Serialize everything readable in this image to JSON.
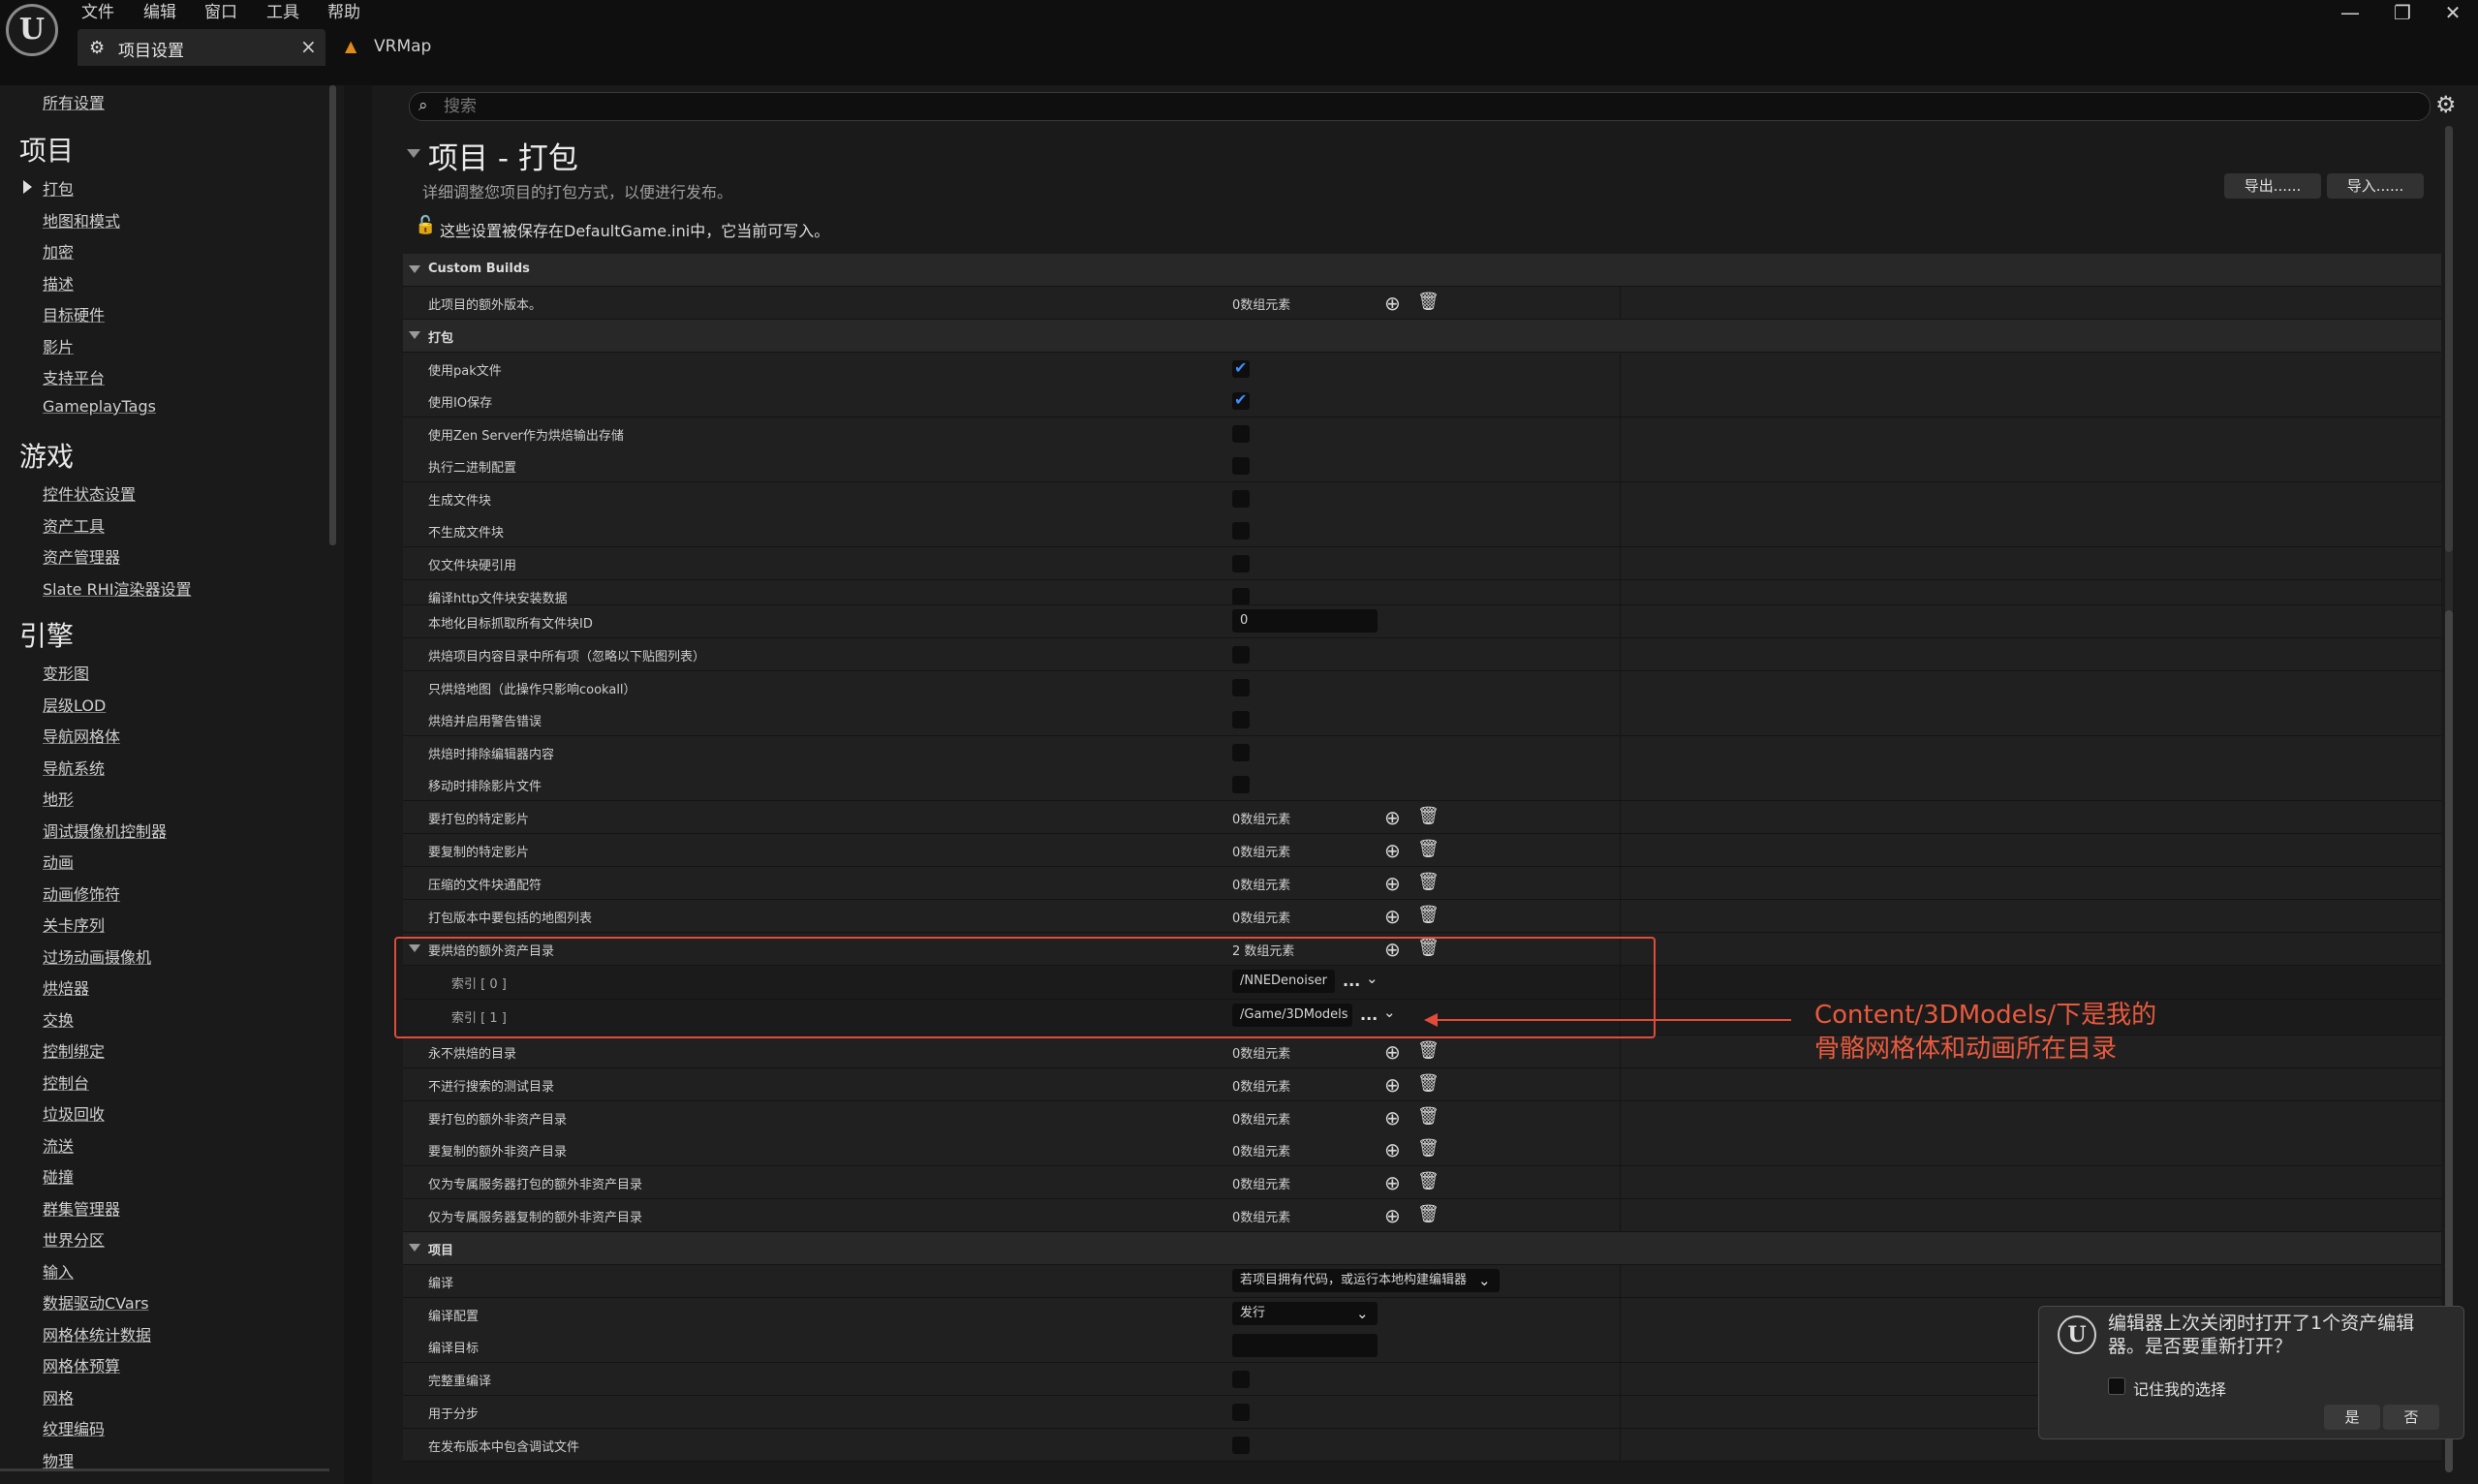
{
  "menu": [
    "文件",
    "编辑",
    "窗口",
    "工具",
    "帮助"
  ],
  "tabs": [
    {
      "label": "项目设置",
      "close": "×"
    },
    {
      "label": "VRMap"
    }
  ],
  "window_controls": {
    "minimize": "—",
    "restore": "❐",
    "close": "✕"
  },
  "sidebar": {
    "all_settings": "所有设置",
    "sections": [
      {
        "title": "项目",
        "items": [
          "打包",
          "地图和模式",
          "加密",
          "描述",
          "目标硬件",
          "影片",
          "支持平台",
          "GameplayTags"
        ]
      },
      {
        "title": "游戏",
        "items": [
          "控件状态设置",
          "资产工具",
          "资产管理器",
          "Slate RHI渲染器设置"
        ]
      },
      {
        "title": "引擎",
        "items": [
          "变形图",
          "层级LOD",
          "导航网格体",
          "导航系统",
          "地形",
          "调试摄像机控制器",
          "动画",
          "动画修饰符",
          "关卡序列",
          "过场动画摄像机",
          "烘焙器",
          "交换",
          "控制绑定",
          "控制台",
          "垃圾回收",
          "流送",
          "碰撞",
          "群集管理器",
          "世界分区",
          "输入",
          "数据驱动CVars",
          "网格体统计数据",
          "网格体预算",
          "网格",
          "纹理编码",
          "物理"
        ]
      }
    ]
  },
  "search": {
    "placeholder": "搜索"
  },
  "page": {
    "title": "项目 - 打包",
    "description": "详细调整您项目的打包方式，以便进行发布。",
    "export_button": "导出......",
    "import_button": "导入......",
    "config_notice": "这些设置被保存在DefaultGame.ini中，它当前可写入。"
  },
  "rows": [
    {
      "type": "group",
      "label": "Custom Builds"
    },
    {
      "type": "array",
      "label": "此项目的额外版本。",
      "value": "0数组元素"
    },
    {
      "type": "group",
      "label": "打包"
    },
    {
      "type": "check",
      "label": "使用pak文件",
      "checked": true
    },
    {
      "type": "check",
      "label": "使用IO保存",
      "checked": true
    },
    {
      "type": "check",
      "label": "使用Zen Server作为烘焙输出存储",
      "checked": false
    },
    {
      "type": "check",
      "label": "执行二进制配置",
      "checked": false
    },
    {
      "type": "check",
      "label": "生成文件块",
      "checked": false
    },
    {
      "type": "check",
      "label": "不生成文件块",
      "checked": false
    },
    {
      "type": "check",
      "label": "仅文件块硬引用",
      "checked": false
    },
    {
      "type": "partial",
      "label": "编译http文件块安装数据"
    },
    {
      "type": "text",
      "label": "本地化目标抓取所有文件块ID",
      "value": "0"
    },
    {
      "type": "check",
      "label": "烘焙项目内容目录中所有项（忽略以下贴图列表）",
      "checked": false
    },
    {
      "type": "check",
      "label": "只烘焙地图（此操作只影响cookall）",
      "checked": false
    },
    {
      "type": "check",
      "label": "烘焙并启用警告错误",
      "checked": false
    },
    {
      "type": "check",
      "label": "烘焙时排除编辑器内容",
      "checked": false
    },
    {
      "type": "check",
      "label": "移动时排除影片文件",
      "checked": false
    },
    {
      "type": "array",
      "label": "要打包的特定影片",
      "value": "0数组元素"
    },
    {
      "type": "array",
      "label": "要复制的特定影片",
      "value": "0数组元素"
    },
    {
      "type": "array",
      "label": "压缩的文件块通配符",
      "value": "0数组元素"
    },
    {
      "type": "array",
      "label": "打包版本中要包括的地图列表",
      "value": "0数组元素"
    },
    {
      "type": "arraygroup",
      "label": "要烘焙的额外资产目录",
      "value": "2 数组元素"
    },
    {
      "type": "subpath",
      "label": "索引 [ 0 ]",
      "value": "/NNEDenoiser"
    },
    {
      "type": "subpath",
      "label": "索引 [ 1 ]",
      "value": "/Game/3DModels"
    },
    {
      "type": "array",
      "label": "永不烘焙的目录",
      "value": "0数组元素"
    },
    {
      "type": "array",
      "label": "不进行搜索的测试目录",
      "value": "0数组元素"
    },
    {
      "type": "array",
      "label": "要打包的额外非资产目录",
      "value": "0数组元素"
    },
    {
      "type": "array",
      "label": "要复制的额外非资产目录",
      "value": "0数组元素"
    },
    {
      "type": "array",
      "label": "仅为专属服务器打包的额外非资产目录",
      "value": "0数组元素"
    },
    {
      "type": "array",
      "label": "仅为专属服务器复制的额外非资产目录",
      "value": "0数组元素"
    },
    {
      "type": "group",
      "label": "项目"
    },
    {
      "type": "dropdown",
      "label": "编译",
      "value": "若项目拥有代码，或运行本地构建编辑器"
    },
    {
      "type": "dropdown",
      "label": "编译配置",
      "value": "发行"
    },
    {
      "type": "text",
      "label": "编译目标",
      "value": ""
    },
    {
      "type": "check",
      "label": "完整重编译",
      "checked": false
    },
    {
      "type": "check",
      "label": "用于分步",
      "checked": false
    },
    {
      "type": "check",
      "label": "在发布版本中包含调试文件",
      "checked": false
    }
  ],
  "annotation": {
    "line1": "Content/3DModels/下是我的",
    "line2": "骨骼网格体和动画所在目录"
  },
  "toast": {
    "message": "编辑器上次关闭时打开了1个资产编辑器。是否要重新打开？",
    "remember": "记住我的选择",
    "yes": "是",
    "no": "否"
  },
  "icons": {
    "add": "⊕",
    "delete": "🗑",
    "more": "...",
    "chevron": "⌄",
    "search": "⌕",
    "gear": "⚙",
    "lock": "🔓"
  },
  "colors": {
    "accent_check": "#3d8cff",
    "annotation": "#e04b3a",
    "background": "#1a1a1a"
  }
}
